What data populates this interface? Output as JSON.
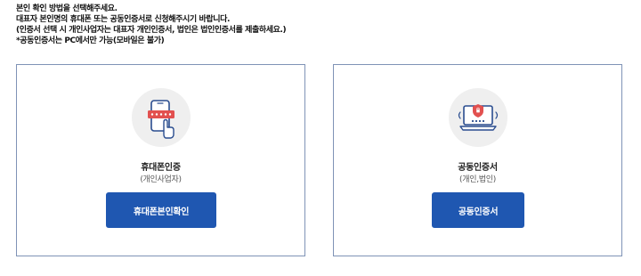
{
  "instructions": {
    "line1": "본인 확인 방법을 선택해주세요.",
    "line2": "대표자 본인명의 휴대폰 또는 공동인증서로 신청해주시기 바랍니다.",
    "line3": "(인증서 선택 시 개인사업자는 대표자 개인인증서, 법인은 법인인증서를 제출하세요.)",
    "line4": "*공동인증서는 PC에서만 가능(모바일은 불가)"
  },
  "phone_option": {
    "icon": "phone-touch-icon",
    "title": "휴대폰인증",
    "subtitle": "(개인사업자)",
    "button_label": "휴대폰본인확인"
  },
  "cert_option": {
    "icon": "laptop-shield-icon",
    "title": "공동인증서",
    "subtitle": "(개인,법인)",
    "button_label": "공동인증서"
  },
  "colors": {
    "button": "#1f57b1",
    "card_border": "#7f93b6",
    "icon_red": "#e2504f",
    "icon_blue": "#2a4d8f",
    "icon_bg": "#efefef"
  }
}
